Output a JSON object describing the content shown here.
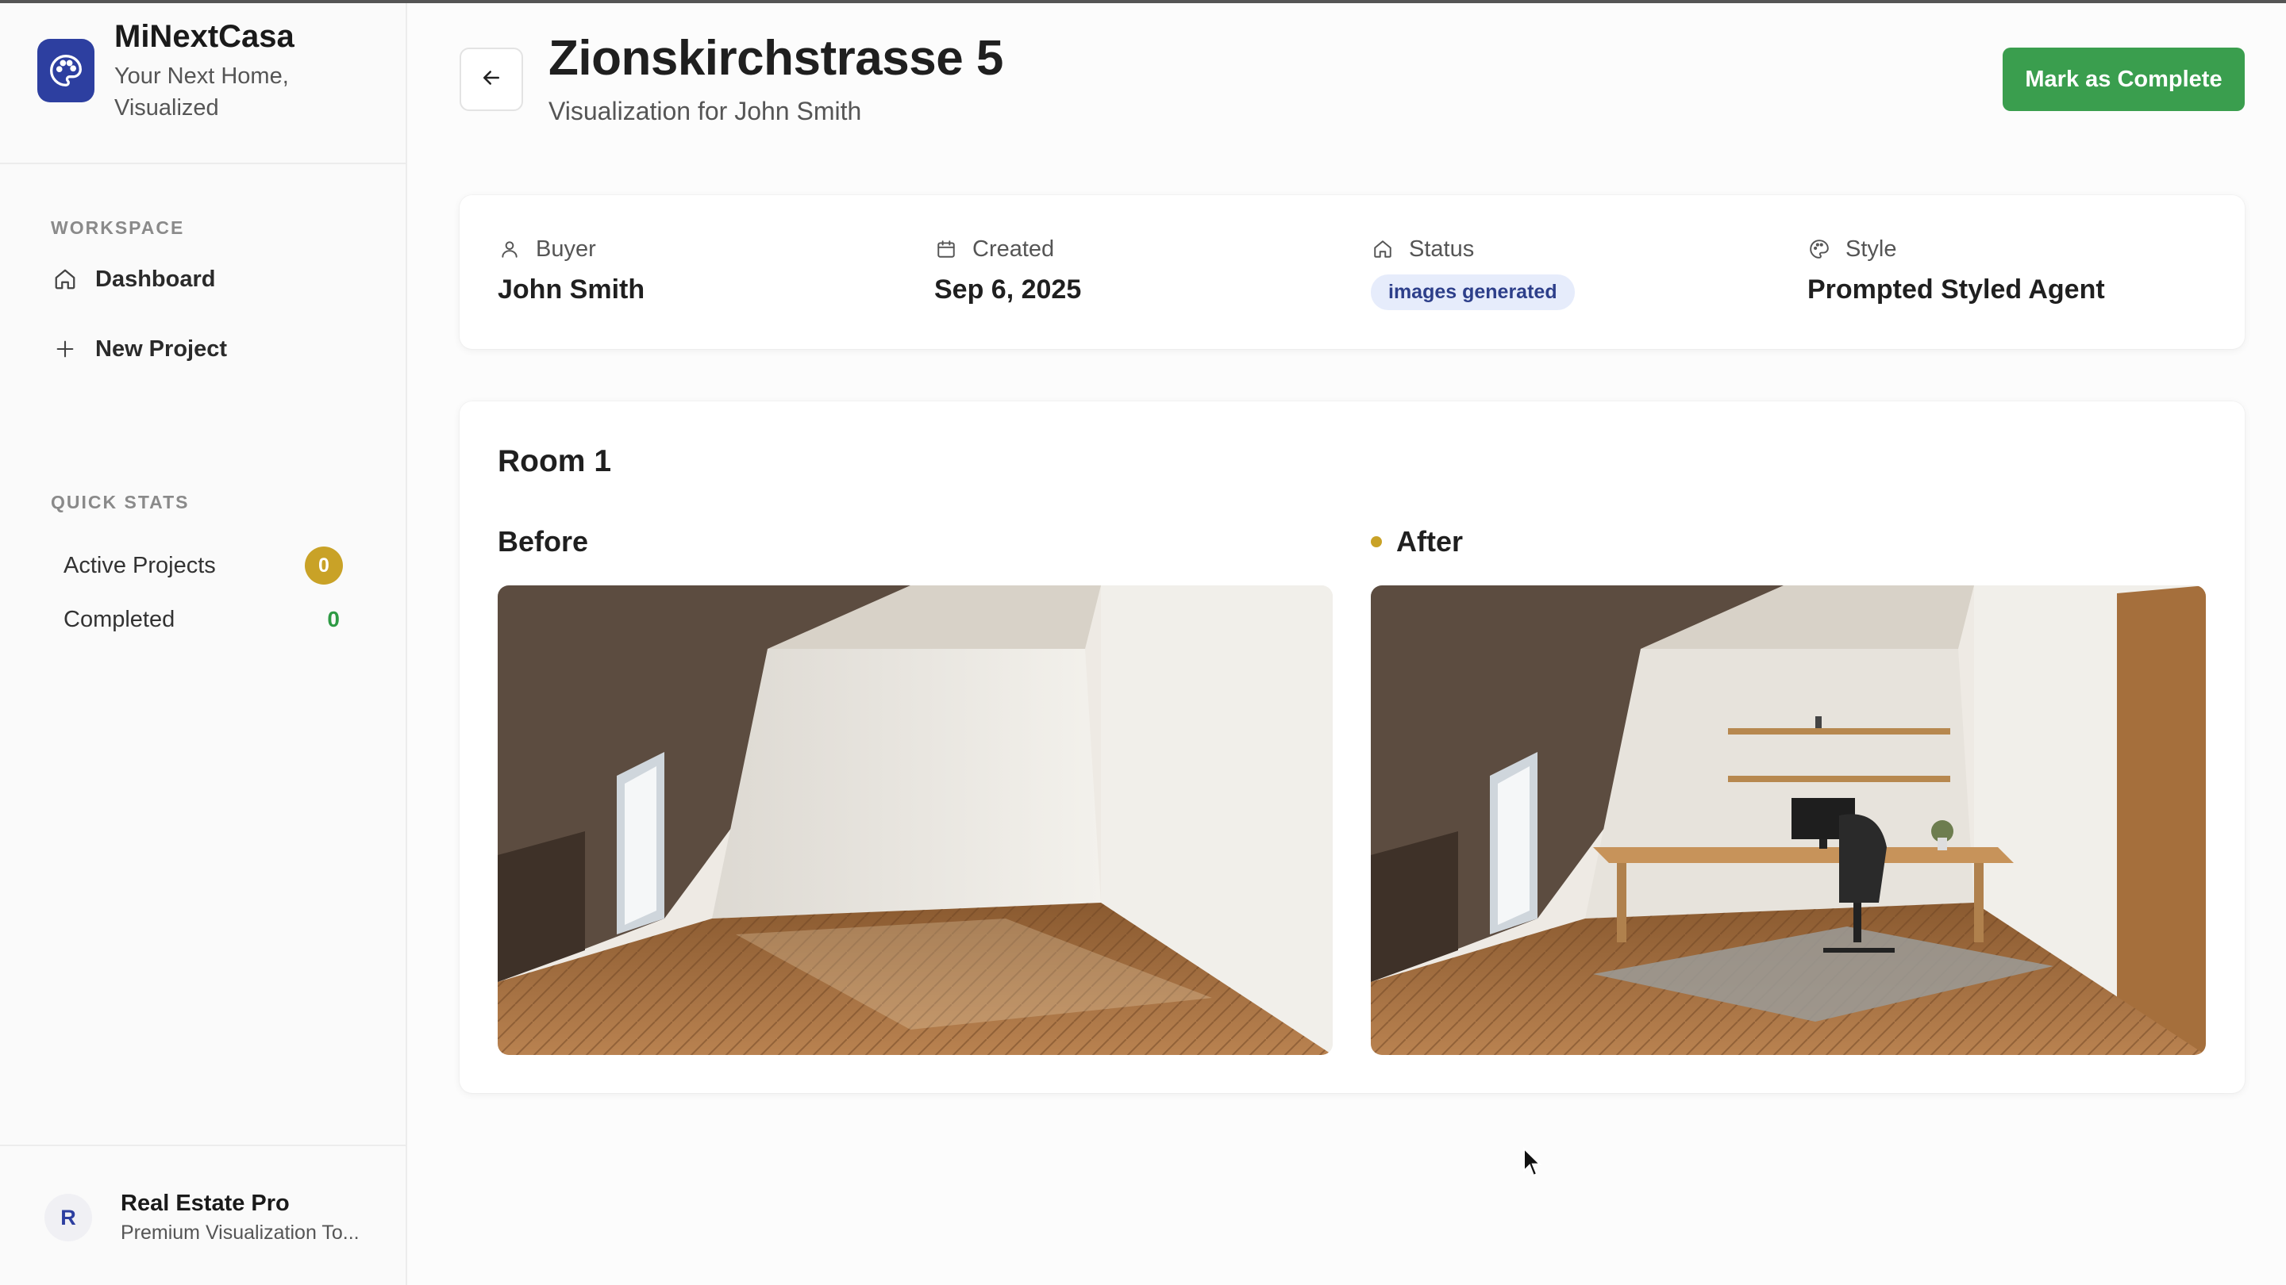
{
  "brand": {
    "name": "MiNextCasa",
    "tagline": "Your Next Home, Visualized",
    "logo_icon": "palette-icon",
    "color": "#2d3fa0"
  },
  "sidebar": {
    "workspace_title": "WORKSPACE",
    "nav": [
      {
        "label": "Dashboard",
        "icon": "home-icon"
      },
      {
        "label": "New Project",
        "icon": "plus-icon"
      }
    ],
    "stats_title": "QUICK STATS",
    "stats": [
      {
        "label": "Active Projects",
        "count": "0",
        "color": "#c9a227"
      },
      {
        "label": "Completed",
        "count": "0",
        "color": "#2e9a44"
      }
    ]
  },
  "user": {
    "initial": "R",
    "name": "Real Estate Pro",
    "subtitle": "Premium Visualization To..."
  },
  "header": {
    "title": "Zionskirchstrasse 5",
    "subtitle": "Visualization for John Smith",
    "back_icon": "arrow-left-icon",
    "complete_label": "Mark as Complete",
    "complete_color": "#3a9e4e"
  },
  "info": {
    "buyer_label": "Buyer",
    "buyer_value": "John Smith",
    "created_label": "Created",
    "created_value": "Sep 6, 2025",
    "status_label": "Status",
    "status_value": "images generated",
    "style_label": "Style",
    "style_value": "Prompted Styled Agent"
  },
  "room": {
    "title": "Room 1",
    "before_label": "Before",
    "after_label": "After",
    "after_dot_color": "#c9a227"
  }
}
